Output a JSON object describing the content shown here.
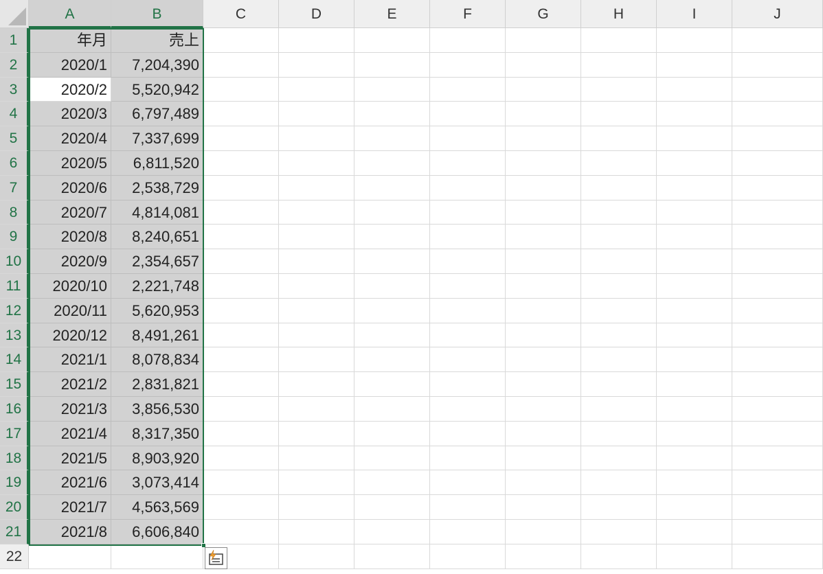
{
  "sheet": {
    "columns": [
      "A",
      "B",
      "C",
      "D",
      "E",
      "F",
      "G",
      "H",
      "I",
      "J"
    ],
    "selected_columns": [
      "A",
      "B"
    ],
    "active_cell": "A3",
    "rows": [
      {
        "num": "1",
        "a": "年月",
        "b": "売上"
      },
      {
        "num": "2",
        "a": "2020/1",
        "b": "7,204,390"
      },
      {
        "num": "3",
        "a": "2020/2",
        "b": "5,520,942"
      },
      {
        "num": "4",
        "a": "2020/3",
        "b": "6,797,489"
      },
      {
        "num": "5",
        "a": "2020/4",
        "b": "7,337,699"
      },
      {
        "num": "6",
        "a": "2020/5",
        "b": "6,811,520"
      },
      {
        "num": "7",
        "a": "2020/6",
        "b": "2,538,729"
      },
      {
        "num": "8",
        "a": "2020/7",
        "b": "4,814,081"
      },
      {
        "num": "9",
        "a": "2020/8",
        "b": "8,240,651"
      },
      {
        "num": "10",
        "a": "2020/9",
        "b": "2,354,657"
      },
      {
        "num": "11",
        "a": "2020/10",
        "b": "2,221,748"
      },
      {
        "num": "12",
        "a": "2020/11",
        "b": "5,620,953"
      },
      {
        "num": "13",
        "a": "2020/12",
        "b": "8,491,261"
      },
      {
        "num": "14",
        "a": "2021/1",
        "b": "8,078,834"
      },
      {
        "num": "15",
        "a": "2021/2",
        "b": "2,831,821"
      },
      {
        "num": "16",
        "a": "2021/3",
        "b": "3,856,530"
      },
      {
        "num": "17",
        "a": "2021/4",
        "b": "8,317,350"
      },
      {
        "num": "18",
        "a": "2021/5",
        "b": "8,903,920"
      },
      {
        "num": "19",
        "a": "2021/6",
        "b": "3,073,414"
      },
      {
        "num": "20",
        "a": "2021/7",
        "b": "4,563,569"
      },
      {
        "num": "21",
        "a": "2021/8",
        "b": "6,606,840"
      },
      {
        "num": "22",
        "a": "",
        "b": ""
      }
    ],
    "selection_color": "#217346",
    "selection_fill": "#d2d2d2",
    "quick_analysis_icon": "quick-analysis-icon"
  }
}
